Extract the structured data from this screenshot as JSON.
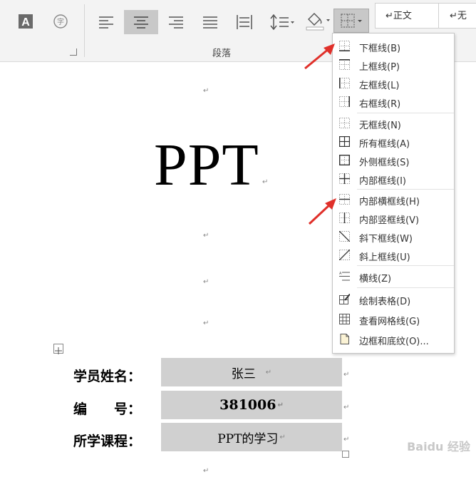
{
  "ribbon": {
    "paragraph_group_label": "段落",
    "style_normal": "↵正文",
    "style_next": "↵无"
  },
  "document": {
    "title": "PPT",
    "paragraph_mark": "↵",
    "table": [
      {
        "label": "学员姓名：",
        "value": "张三"
      },
      {
        "label": "编　　号：",
        "value": "381006"
      },
      {
        "label": "所学课程：",
        "value": "PPT的学习"
      }
    ]
  },
  "border_menu": {
    "items": [
      {
        "label": "下框线(B)",
        "icon": "bottom-border-icon"
      },
      {
        "label": "上框线(P)",
        "icon": "top-border-icon"
      },
      {
        "label": "左框线(L)",
        "icon": "left-border-icon"
      },
      {
        "label": "右框线(R)",
        "icon": "right-border-icon"
      },
      {
        "label": "无框线(N)",
        "icon": "no-border-icon"
      },
      {
        "label": "所有框线(A)",
        "icon": "all-borders-icon"
      },
      {
        "label": "外侧框线(S)",
        "icon": "outside-borders-icon"
      },
      {
        "label": "内部框线(I)",
        "icon": "inside-borders-icon"
      },
      {
        "label": "内部横框线(H)",
        "icon": "inside-horizontal-border-icon"
      },
      {
        "label": "内部竖框线(V)",
        "icon": "inside-vertical-border-icon"
      },
      {
        "label": "斜下框线(W)",
        "icon": "diagonal-down-border-icon"
      },
      {
        "label": "斜上框线(U)",
        "icon": "diagonal-up-border-icon"
      },
      {
        "label": "横线(Z)",
        "icon": "horizontal-line-icon"
      },
      {
        "label": "绘制表格(D)",
        "icon": "draw-table-icon"
      },
      {
        "label": "查看网格线(G)",
        "icon": "view-gridlines-icon"
      },
      {
        "label": "边框和底纹(O)...",
        "icon": "borders-shading-icon"
      }
    ]
  },
  "watermark": "Baidu 经验",
  "colors": {
    "arrow": "#e0302a",
    "cell_fill": "#d0d0d0",
    "selected_button": "#c8c8c8"
  }
}
